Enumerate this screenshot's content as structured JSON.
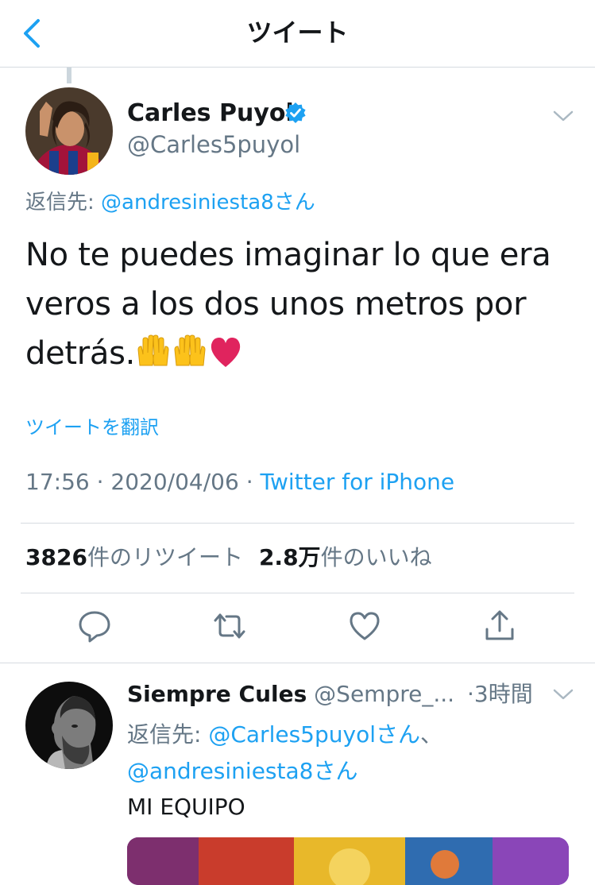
{
  "header": {
    "title": "ツイート",
    "back_icon": "chevron-left-icon",
    "accent": "#1da1f2"
  },
  "tweet": {
    "author_name": "Carles Puyol",
    "author_handle": "@Carles5puyol",
    "verified": true,
    "reply_prefix": "返信先: ",
    "reply_to": "@andresiniesta8さん",
    "text": "No te puedes imaginar lo que era veros a los dos unos metros por detrás.",
    "emojis": [
      "raising-hands-emoji",
      "raising-hands-emoji",
      "red-heart-emoji"
    ],
    "translate_label": "ツイートを翻訳",
    "time": "17:56",
    "date": "2020/04/06",
    "source": "Twitter for iPhone",
    "separator": " · ",
    "retweet_count": "3826",
    "retweet_label": "件のリツイート",
    "like_count": "2.8万",
    "like_label": "件のいいね"
  },
  "actions": [
    {
      "name": "reply",
      "icon": "reply-icon"
    },
    {
      "name": "retweet",
      "icon": "retweet-icon"
    },
    {
      "name": "like",
      "icon": "heart-icon"
    },
    {
      "name": "share",
      "icon": "share-icon"
    }
  ],
  "reply": {
    "author_name": "Siempre Cules",
    "author_handle": "@Sempre_...",
    "time": "·3時間",
    "reply_prefix": "返信先: ",
    "reply_to_1": "@Carles5puyolさん",
    "reply_sep": "、",
    "reply_to_2": "@andresiniesta8さん",
    "text": "MI EQUIPO"
  },
  "colors": {
    "link": "#1da1f2",
    "secondary": "#657786",
    "divider": "#d6dbe0",
    "heart": "#e0245e"
  }
}
